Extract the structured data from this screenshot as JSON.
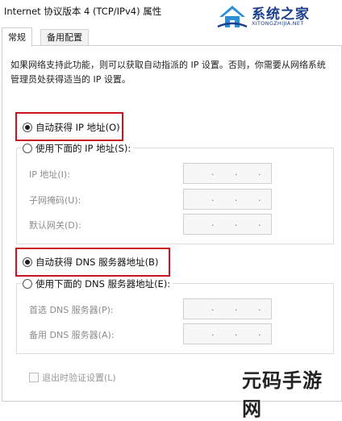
{
  "window": {
    "title": "Internet 协议版本 4 (TCP/IPv4) 属性"
  },
  "watermark_top": {
    "name": "系统之家",
    "url": "XITONGZHIJIA.NET"
  },
  "watermark_bottom": {
    "text": "元码手游网"
  },
  "tabs": [
    {
      "label": "常规",
      "active": true
    },
    {
      "label": "备用配置",
      "active": false
    }
  ],
  "description": "如果网络支持此功能，则可以获取自动指派的 IP 设置。否则，你需要从网络系统管理员处获得适当的 IP 设置。",
  "ip_section": {
    "auto_label": "自动获得 IP 地址(O)",
    "auto_checked": true,
    "manual_label": "使用下面的 IP 地址(S):",
    "manual_checked": false,
    "fields": [
      {
        "label": "IP 地址(I):"
      },
      {
        "label": "子网掩码(U):"
      },
      {
        "label": "默认网关(D):"
      }
    ]
  },
  "dns_section": {
    "auto_label": "自动获得 DNS 服务器地址(B)",
    "auto_checked": true,
    "manual_label": "使用下面的 DNS 服务器地址(E):",
    "manual_checked": false,
    "fields": [
      {
        "label": "首选 DNS 服务器(P):"
      },
      {
        "label": "备用 DNS 服务器(A):"
      }
    ]
  },
  "validate_on_exit": {
    "label": "退出时验证设置(L)",
    "checked": false
  },
  "ip_separator": "."
}
